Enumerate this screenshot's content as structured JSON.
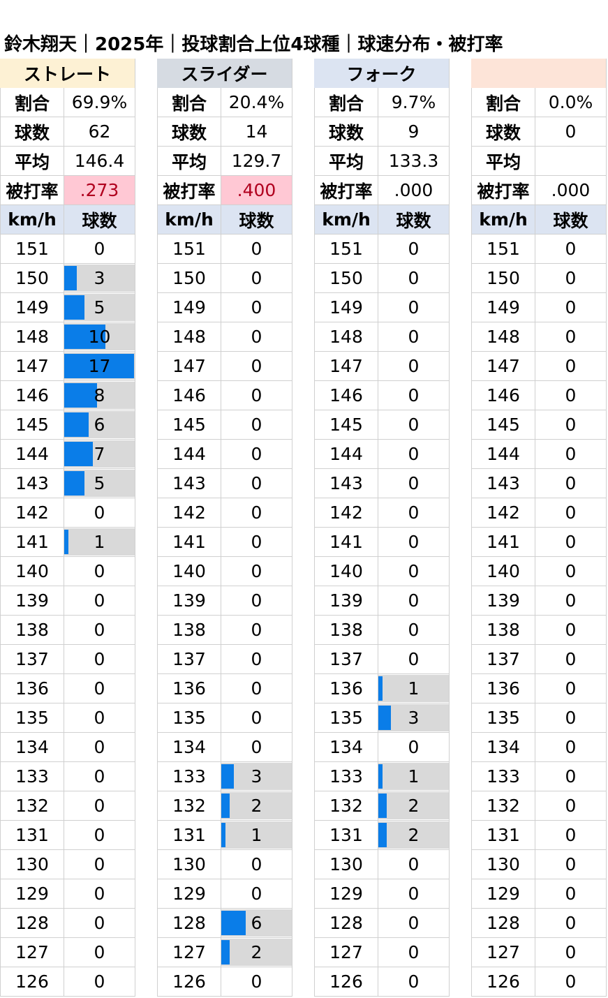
{
  "title": "鈴木翔天｜2025年｜投球割合上位4球種｜球速分布・被打率",
  "labels": {
    "ratio": "割合",
    "count": "球数",
    "avg": "平均",
    "ba": "被打率",
    "kmh": "km/h",
    "balls": "球数"
  },
  "colors": {
    "bar": "#0a7de8",
    "bar_background": "#d9d9d9",
    "header_blue": "#dce4f2",
    "highlight_pink": "#ffc8d4",
    "highlight_text": "#b0001e"
  },
  "chart_data": {
    "type": "bar",
    "orientation": "horizontal",
    "speeds": [
      151,
      150,
      149,
      148,
      147,
      146,
      145,
      144,
      143,
      142,
      141,
      140,
      139,
      138,
      137,
      136,
      135,
      134,
      133,
      132,
      131,
      130,
      129,
      128,
      127,
      126
    ],
    "bar_max": 17,
    "pitches": [
      {
        "name": "ストレート",
        "header_color": "#fdf1d4",
        "ratio": "69.9%",
        "count": "62",
        "avg": "146.4",
        "ba": ".273",
        "ba_highlight": true,
        "counts": [
          0,
          3,
          5,
          10,
          17,
          8,
          6,
          7,
          5,
          0,
          1,
          0,
          0,
          0,
          0,
          0,
          0,
          0,
          0,
          0,
          0,
          0,
          0,
          0,
          0,
          0
        ]
      },
      {
        "name": "スライダー",
        "header_color": "#d6dbe2",
        "ratio": "20.4%",
        "count": "14",
        "avg": "129.7",
        "ba": ".400",
        "ba_highlight": true,
        "counts": [
          0,
          0,
          0,
          0,
          0,
          0,
          0,
          0,
          0,
          0,
          0,
          0,
          0,
          0,
          0,
          0,
          0,
          0,
          3,
          2,
          1,
          0,
          0,
          6,
          2,
          0
        ]
      },
      {
        "name": "フォーク",
        "header_color": "#dce4f2",
        "ratio": "9.7%",
        "count": "9",
        "avg": "133.3",
        "ba": ".000",
        "ba_highlight": false,
        "counts": [
          0,
          0,
          0,
          0,
          0,
          0,
          0,
          0,
          0,
          0,
          0,
          0,
          0,
          0,
          0,
          1,
          3,
          0,
          1,
          2,
          2,
          0,
          0,
          0,
          0,
          0
        ]
      },
      {
        "name": "",
        "header_color": "#fde4d8",
        "ratio": "0.0%",
        "count": "0",
        "avg": "",
        "ba": ".000",
        "ba_highlight": false,
        "counts": [
          0,
          0,
          0,
          0,
          0,
          0,
          0,
          0,
          0,
          0,
          0,
          0,
          0,
          0,
          0,
          0,
          0,
          0,
          0,
          0,
          0,
          0,
          0,
          0,
          0,
          0
        ]
      }
    ]
  }
}
